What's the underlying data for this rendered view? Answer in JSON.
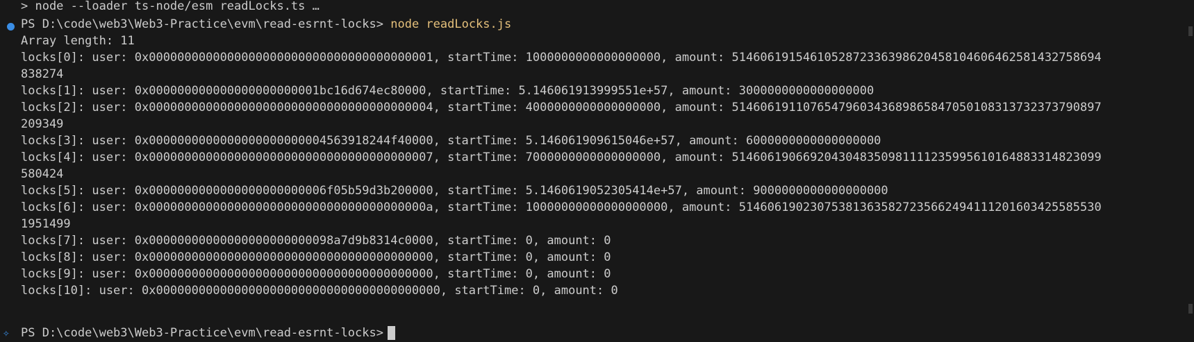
{
  "terminal": {
    "top_line": "> node --loader ts-node/esm readLocks.ts …",
    "prompt1": "PS D:\\code\\web3\\Web3-Practice\\evm\\read-esrnt-locks>",
    "command": "node readLocks.js",
    "array_length": "Array length: 11",
    "lines": [
      "locks[0]: user: 0x0000000000000000000000000000000000000001, startTime: 1000000000000000000, amount: 5146061915461052872336398620458104606462581432758694",
      "838274",
      "locks[1]: user: 0x000000000000000000000001bc16d674ec80000, startTime: 5.146061913999551e+57, amount: 3000000000000000000",
      "locks[2]: user: 0x0000000000000000000000000000000000000004, startTime: 4000000000000000000, amount: 5146061911076547960343689865847050108313732373790897",
      "209349",
      "locks[3]: user: 0x0000000000000000000000004563918244f40000, startTime: 5.146061909615046e+57, amount: 6000000000000000000",
      "locks[4]: user: 0x0000000000000000000000000000000000000007, startTime: 7000000000000000000, amount: 5146061906692043048350981111235995610164883314823099",
      "580424",
      "locks[5]: user: 0x0000000000000000000000006f05b59d3b200000, startTime: 5.1460619052305414e+57, amount: 9000000000000000000",
      "locks[6]: user: 0x000000000000000000000000000000000000000a, startTime: 10000000000000000000, amount: 514606190230753813635827235662494111201603425585530",
      "1951499",
      "locks[7]: user: 0x00000000000000000000000098a7d9b8314c0000, startTime: 0, amount: 0",
      "locks[8]: user: 0x0000000000000000000000000000000000000000, startTime: 0, amount: 0",
      "locks[9]: user: 0x0000000000000000000000000000000000000000, startTime: 0, amount: 0",
      "locks[10]: user: 0x0000000000000000000000000000000000000000, startTime: 0, amount: 0"
    ],
    "prompt2": "PS D:\\code\\web3\\Web3-Practice\\evm\\read-esrnt-locks>"
  },
  "colors": {
    "background": "#181818",
    "text": "#cccccc",
    "command": "#e5c07b",
    "accent": "#3a8ee6"
  },
  "icons": {
    "status_dot": "circle-icon",
    "sparkle": "sparkle-icon"
  }
}
